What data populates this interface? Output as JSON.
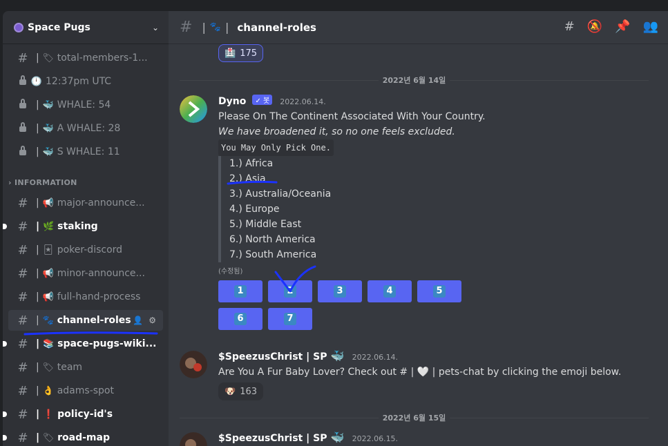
{
  "server": {
    "name": "Space Pugs"
  },
  "sidebar": {
    "channels_top": [
      {
        "icon": "🏷",
        "label": "total-members-1..."
      },
      {
        "icon": "🕛",
        "label": "12:37pm UTC"
      },
      {
        "icon": "🐳",
        "label": "WHALE: 54"
      },
      {
        "icon": "🐳",
        "label": "A WHALE: 28"
      },
      {
        "icon": "🐳",
        "label": "S WHALE: 11"
      }
    ],
    "category": "INFORMATION",
    "channels": [
      {
        "icon": "📢",
        "label": "major-announce..."
      },
      {
        "icon": "🌿",
        "label": "staking"
      },
      {
        "icon": "🃏",
        "label": "poker-discord"
      },
      {
        "icon": "📢",
        "label": "minor-announce..."
      },
      {
        "icon": "📢",
        "label": "full-hand-process"
      },
      {
        "icon": "🐾",
        "label": "channel-roles"
      },
      {
        "icon": "📚",
        "label": "space-pugs-wiki..."
      },
      {
        "icon": "🏷",
        "label": "team"
      },
      {
        "icon": "👌",
        "label": "adams-spot"
      },
      {
        "icon": "❗",
        "label": "policy-id's"
      },
      {
        "icon": "🏷",
        "label": "road-map"
      }
    ]
  },
  "header": {
    "channel_icon": "🐾",
    "channel_name": "channel-roles",
    "separator": "|"
  },
  "reaction_top": {
    "emoji": "🏥",
    "count": "175"
  },
  "date1": "2022년 6월 14일",
  "dyno": {
    "name": "Dyno",
    "bot_tag": "✓ 봇",
    "timestamp": "2022.06.14.",
    "line1": "Please On The Continent Associated With Your Country.",
    "line2": "We have broadened it, so no one feels excluded.",
    "code": "You May Only Pick One.",
    "options": [
      "1.) Africa",
      "2.) Asia",
      "3.) Australia/Oceania",
      "4.) Europe",
      "5.) Middle East",
      "6.) North America",
      "7.) South America"
    ],
    "edited": "(수정됨)",
    "buttons": [
      "1",
      "2",
      "3",
      "4",
      "5",
      "6",
      "7"
    ]
  },
  "speezus": {
    "name": "$SpeezusChrist | SP",
    "timestamp": "2022.06.14.",
    "text": "Are You A Fur Baby Lover? Check out # | 🤍 | pets-chat by clicking the emoji below.",
    "reaction": {
      "emoji": "🐶",
      "count": "163"
    }
  },
  "date2": "2022년 6월 15일",
  "speezus2": {
    "name": "$SpeezusChrist | SP",
    "timestamp": "2022.06.15."
  }
}
